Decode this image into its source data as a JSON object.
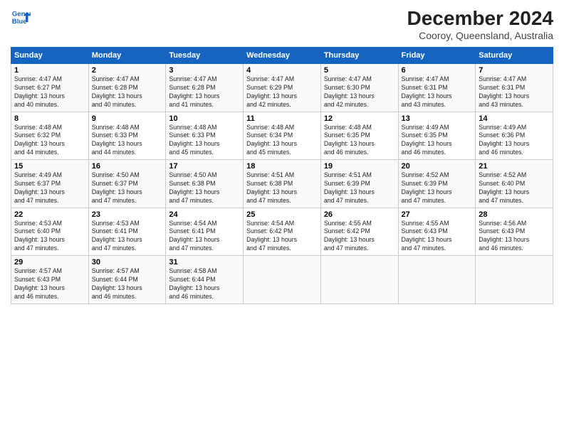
{
  "header": {
    "logo_line1": "General",
    "logo_line2": "Blue",
    "title": "December 2024",
    "subtitle": "Cooroy, Queensland, Australia"
  },
  "days_of_week": [
    "Sunday",
    "Monday",
    "Tuesday",
    "Wednesday",
    "Thursday",
    "Friday",
    "Saturday"
  ],
  "weeks": [
    [
      {
        "day": 1,
        "info": "Sunrise: 4:47 AM\nSunset: 6:27 PM\nDaylight: 13 hours\nand 40 minutes."
      },
      {
        "day": 2,
        "info": "Sunrise: 4:47 AM\nSunset: 6:28 PM\nDaylight: 13 hours\nand 40 minutes."
      },
      {
        "day": 3,
        "info": "Sunrise: 4:47 AM\nSunset: 6:28 PM\nDaylight: 13 hours\nand 41 minutes."
      },
      {
        "day": 4,
        "info": "Sunrise: 4:47 AM\nSunset: 6:29 PM\nDaylight: 13 hours\nand 42 minutes."
      },
      {
        "day": 5,
        "info": "Sunrise: 4:47 AM\nSunset: 6:30 PM\nDaylight: 13 hours\nand 42 minutes."
      },
      {
        "day": 6,
        "info": "Sunrise: 4:47 AM\nSunset: 6:31 PM\nDaylight: 13 hours\nand 43 minutes."
      },
      {
        "day": 7,
        "info": "Sunrise: 4:47 AM\nSunset: 6:31 PM\nDaylight: 13 hours\nand 43 minutes."
      }
    ],
    [
      {
        "day": 8,
        "info": "Sunrise: 4:48 AM\nSunset: 6:32 PM\nDaylight: 13 hours\nand 44 minutes."
      },
      {
        "day": 9,
        "info": "Sunrise: 4:48 AM\nSunset: 6:33 PM\nDaylight: 13 hours\nand 44 minutes."
      },
      {
        "day": 10,
        "info": "Sunrise: 4:48 AM\nSunset: 6:33 PM\nDaylight: 13 hours\nand 45 minutes."
      },
      {
        "day": 11,
        "info": "Sunrise: 4:48 AM\nSunset: 6:34 PM\nDaylight: 13 hours\nand 45 minutes."
      },
      {
        "day": 12,
        "info": "Sunrise: 4:48 AM\nSunset: 6:35 PM\nDaylight: 13 hours\nand 46 minutes."
      },
      {
        "day": 13,
        "info": "Sunrise: 4:49 AM\nSunset: 6:35 PM\nDaylight: 13 hours\nand 46 minutes."
      },
      {
        "day": 14,
        "info": "Sunrise: 4:49 AM\nSunset: 6:36 PM\nDaylight: 13 hours\nand 46 minutes."
      }
    ],
    [
      {
        "day": 15,
        "info": "Sunrise: 4:49 AM\nSunset: 6:37 PM\nDaylight: 13 hours\nand 47 minutes."
      },
      {
        "day": 16,
        "info": "Sunrise: 4:50 AM\nSunset: 6:37 PM\nDaylight: 13 hours\nand 47 minutes."
      },
      {
        "day": 17,
        "info": "Sunrise: 4:50 AM\nSunset: 6:38 PM\nDaylight: 13 hours\nand 47 minutes."
      },
      {
        "day": 18,
        "info": "Sunrise: 4:51 AM\nSunset: 6:38 PM\nDaylight: 13 hours\nand 47 minutes."
      },
      {
        "day": 19,
        "info": "Sunrise: 4:51 AM\nSunset: 6:39 PM\nDaylight: 13 hours\nand 47 minutes."
      },
      {
        "day": 20,
        "info": "Sunrise: 4:52 AM\nSunset: 6:39 PM\nDaylight: 13 hours\nand 47 minutes."
      },
      {
        "day": 21,
        "info": "Sunrise: 4:52 AM\nSunset: 6:40 PM\nDaylight: 13 hours\nand 47 minutes."
      }
    ],
    [
      {
        "day": 22,
        "info": "Sunrise: 4:53 AM\nSunset: 6:40 PM\nDaylight: 13 hours\nand 47 minutes."
      },
      {
        "day": 23,
        "info": "Sunrise: 4:53 AM\nSunset: 6:41 PM\nDaylight: 13 hours\nand 47 minutes."
      },
      {
        "day": 24,
        "info": "Sunrise: 4:54 AM\nSunset: 6:41 PM\nDaylight: 13 hours\nand 47 minutes."
      },
      {
        "day": 25,
        "info": "Sunrise: 4:54 AM\nSunset: 6:42 PM\nDaylight: 13 hours\nand 47 minutes."
      },
      {
        "day": 26,
        "info": "Sunrise: 4:55 AM\nSunset: 6:42 PM\nDaylight: 13 hours\nand 47 minutes."
      },
      {
        "day": 27,
        "info": "Sunrise: 4:55 AM\nSunset: 6:43 PM\nDaylight: 13 hours\nand 47 minutes."
      },
      {
        "day": 28,
        "info": "Sunrise: 4:56 AM\nSunset: 6:43 PM\nDaylight: 13 hours\nand 46 minutes."
      }
    ],
    [
      {
        "day": 29,
        "info": "Sunrise: 4:57 AM\nSunset: 6:43 PM\nDaylight: 13 hours\nand 46 minutes."
      },
      {
        "day": 30,
        "info": "Sunrise: 4:57 AM\nSunset: 6:44 PM\nDaylight: 13 hours\nand 46 minutes."
      },
      {
        "day": 31,
        "info": "Sunrise: 4:58 AM\nSunset: 6:44 PM\nDaylight: 13 hours\nand 46 minutes."
      },
      null,
      null,
      null,
      null
    ]
  ]
}
